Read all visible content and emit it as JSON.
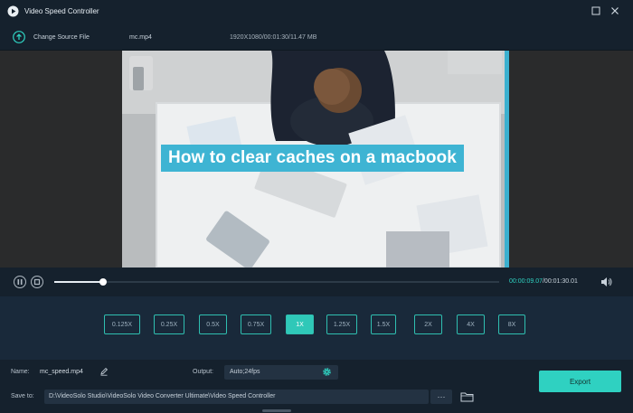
{
  "window": {
    "title": "Video Speed Controller"
  },
  "file_bar": {
    "change_source_label": "Change Source File",
    "file_name": "mc.mp4",
    "file_meta": "1920X1080/00:01:30/11.47 MB"
  },
  "video": {
    "caption": "How to clear caches on a macbook"
  },
  "playback": {
    "progress": 0.11,
    "current_time": "00:00:09.07",
    "total_time": "/00:01:30.01"
  },
  "speeds": {
    "options": [
      "0.125X",
      "0.25X",
      "0.5X",
      "0.75X",
      "1X",
      "1.25X",
      "1.5X",
      "2X",
      "4X",
      "8X"
    ],
    "selected": "1X"
  },
  "output_settings": {
    "name_label": "Name:",
    "name_value": "mc_speed.mp4",
    "output_label": "Output:",
    "output_value": "Auto;24fps",
    "save_label": "Save to:",
    "save_path": "D:\\VideoSolo Studio\\VideoSolo Video Converter Ultimate\\Video Speed Controller",
    "browse_label": "···",
    "export_label": "Export"
  },
  "colors": {
    "accent": "#2fd1c1",
    "background": "#15212d",
    "panel": "#19293a"
  }
}
